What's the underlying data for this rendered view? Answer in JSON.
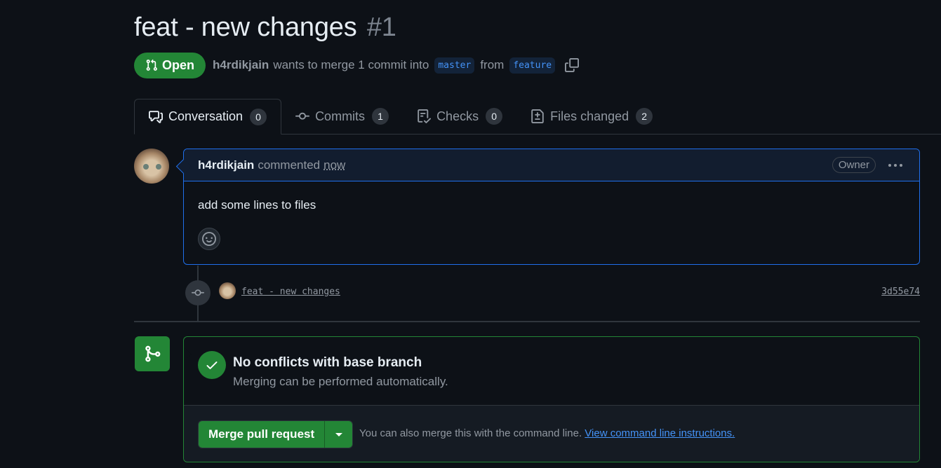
{
  "pr": {
    "title": "feat - new changes",
    "number": "#1",
    "state": "Open",
    "author": "h4rdikjain",
    "summary": "wants to merge 1 commit into",
    "base_branch": "master",
    "from_text": "from",
    "head_branch": "feature"
  },
  "tabs": [
    {
      "label": "Conversation",
      "count": "0",
      "icon": "comment-discussion-icon"
    },
    {
      "label": "Commits",
      "count": "1",
      "icon": "git-commit-icon"
    },
    {
      "label": "Checks",
      "count": "0",
      "icon": "checklist-icon"
    },
    {
      "label": "Files changed",
      "count": "2",
      "icon": "file-diff-icon"
    }
  ],
  "comment": {
    "author": "h4rdikjain",
    "action": "commented",
    "time": "now",
    "role": "Owner",
    "body": "add some lines to files"
  },
  "commit": {
    "message": "feat - new changes",
    "sha": "3d55e74"
  },
  "merge": {
    "status_title": "No conflicts with base branch",
    "status_subtitle": "Merging can be performed automatically.",
    "button_label": "Merge pull request",
    "hint": "You can also merge this with the command line.",
    "hint_link": "View command line instructions."
  },
  "colors": {
    "background": "#0d1117",
    "open_green": "#238636",
    "accent_blue": "#1f6feb",
    "link_blue": "#4493f8"
  }
}
